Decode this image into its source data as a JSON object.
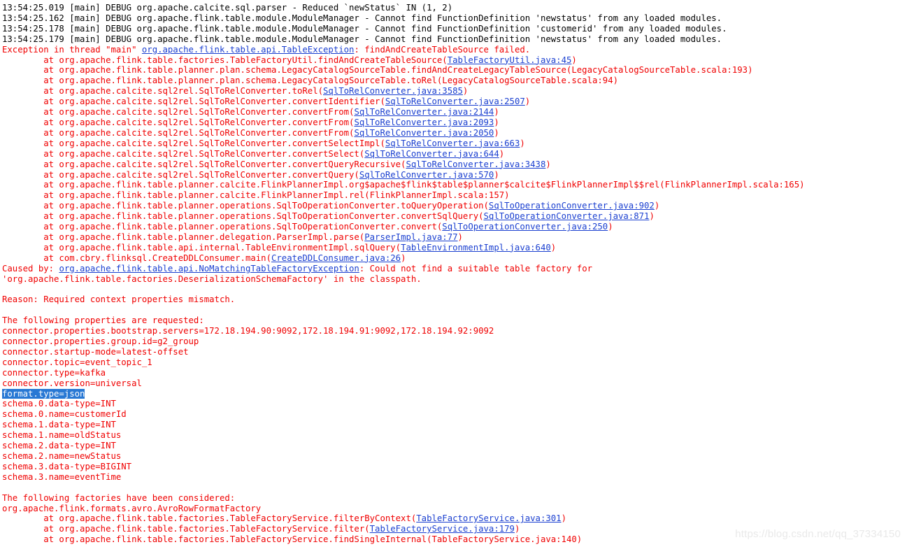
{
  "console": {
    "title": "Run console output",
    "colors": {
      "background": "#ffffff",
      "debug_text": "#000000",
      "error_text": "#f00000",
      "link": "#1a3fd0",
      "selection_background": "#2878d4",
      "selection_text": "#ffffff",
      "watermark": "#e9e9e9"
    },
    "lines": [
      {
        "kind": "debug",
        "segments": [
          {
            "type": "text",
            "text": "13:54:25.019 [main] DEBUG org.apache.calcite.sql.parser - Reduced `newStatus` IN (1, 2)"
          }
        ]
      },
      {
        "kind": "debug",
        "segments": [
          {
            "type": "text",
            "text": "13:54:25.162 [main] DEBUG org.apache.flink.table.module.ModuleManager - Cannot find FunctionDefinition 'newstatus' from any loaded modules."
          }
        ]
      },
      {
        "kind": "debug",
        "segments": [
          {
            "type": "text",
            "text": "13:54:25.178 [main] DEBUG org.apache.flink.table.module.ModuleManager - Cannot find FunctionDefinition 'customerid' from any loaded modules."
          }
        ]
      },
      {
        "kind": "debug",
        "segments": [
          {
            "type": "text",
            "text": "13:54:25.179 [main] DEBUG org.apache.flink.table.module.ModuleManager - Cannot find FunctionDefinition 'newstatus' from any loaded modules."
          }
        ]
      },
      {
        "kind": "err",
        "segments": [
          {
            "type": "text",
            "text": "Exception in thread \"main\" "
          },
          {
            "type": "link",
            "text": "org.apache.flink.table.api.TableException"
          },
          {
            "type": "text",
            "text": ": findAndCreateTableSource failed."
          }
        ]
      },
      {
        "kind": "err",
        "segments": [
          {
            "type": "text",
            "text": "        at org.apache.flink.table.factories.TableFactoryUtil.findAndCreateTableSource("
          },
          {
            "type": "link",
            "text": "TableFactoryUtil.java:45"
          },
          {
            "type": "text",
            "text": ")"
          }
        ]
      },
      {
        "kind": "err",
        "segments": [
          {
            "type": "text",
            "text": "        at org.apache.flink.table.planner.plan.schema.LegacyCatalogSourceTable.findAndCreateLegacyTableSource(LegacyCatalogSourceTable.scala:193)"
          }
        ]
      },
      {
        "kind": "err",
        "segments": [
          {
            "type": "text",
            "text": "        at org.apache.flink.table.planner.plan.schema.LegacyCatalogSourceTable.toRel(LegacyCatalogSourceTable.scala:94)"
          }
        ]
      },
      {
        "kind": "err",
        "segments": [
          {
            "type": "text",
            "text": "        at org.apache.calcite.sql2rel.SqlToRelConverter.toRel("
          },
          {
            "type": "link",
            "text": "SqlToRelConverter.java:3585"
          },
          {
            "type": "text",
            "text": ")"
          }
        ]
      },
      {
        "kind": "err",
        "segments": [
          {
            "type": "text",
            "text": "        at org.apache.calcite.sql2rel.SqlToRelConverter.convertIdentifier("
          },
          {
            "type": "link",
            "text": "SqlToRelConverter.java:2507"
          },
          {
            "type": "text",
            "text": ")"
          }
        ]
      },
      {
        "kind": "err",
        "segments": [
          {
            "type": "text",
            "text": "        at org.apache.calcite.sql2rel.SqlToRelConverter.convertFrom("
          },
          {
            "type": "link",
            "text": "SqlToRelConverter.java:2144"
          },
          {
            "type": "text",
            "text": ")"
          }
        ]
      },
      {
        "kind": "err",
        "segments": [
          {
            "type": "text",
            "text": "        at org.apache.calcite.sql2rel.SqlToRelConverter.convertFrom("
          },
          {
            "type": "link",
            "text": "SqlToRelConverter.java:2093"
          },
          {
            "type": "text",
            "text": ")"
          }
        ]
      },
      {
        "kind": "err",
        "segments": [
          {
            "type": "text",
            "text": "        at org.apache.calcite.sql2rel.SqlToRelConverter.convertFrom("
          },
          {
            "type": "link",
            "text": "SqlToRelConverter.java:2050"
          },
          {
            "type": "text",
            "text": ")"
          }
        ]
      },
      {
        "kind": "err",
        "segments": [
          {
            "type": "text",
            "text": "        at org.apache.calcite.sql2rel.SqlToRelConverter.convertSelectImpl("
          },
          {
            "type": "link",
            "text": "SqlToRelConverter.java:663"
          },
          {
            "type": "text",
            "text": ")"
          }
        ]
      },
      {
        "kind": "err",
        "segments": [
          {
            "type": "text",
            "text": "        at org.apache.calcite.sql2rel.SqlToRelConverter.convertSelect("
          },
          {
            "type": "link",
            "text": "SqlToRelConverter.java:644"
          },
          {
            "type": "text",
            "text": ")"
          }
        ]
      },
      {
        "kind": "err",
        "segments": [
          {
            "type": "text",
            "text": "        at org.apache.calcite.sql2rel.SqlToRelConverter.convertQueryRecursive("
          },
          {
            "type": "link",
            "text": "SqlToRelConverter.java:3438"
          },
          {
            "type": "text",
            "text": ")"
          }
        ]
      },
      {
        "kind": "err",
        "segments": [
          {
            "type": "text",
            "text": "        at org.apache.calcite.sql2rel.SqlToRelConverter.convertQuery("
          },
          {
            "type": "link",
            "text": "SqlToRelConverter.java:570"
          },
          {
            "type": "text",
            "text": ")"
          }
        ]
      },
      {
        "kind": "err",
        "segments": [
          {
            "type": "text",
            "text": "        at org.apache.flink.table.planner.calcite.FlinkPlannerImpl.org$apache$flink$table$planner$calcite$FlinkPlannerImpl$$rel(FlinkPlannerImpl.scala:165)"
          }
        ]
      },
      {
        "kind": "err",
        "segments": [
          {
            "type": "text",
            "text": "        at org.apache.flink.table.planner.calcite.FlinkPlannerImpl.rel(FlinkPlannerImpl.scala:157)"
          }
        ]
      },
      {
        "kind": "err",
        "segments": [
          {
            "type": "text",
            "text": "        at org.apache.flink.table.planner.operations.SqlToOperationConverter.toQueryOperation("
          },
          {
            "type": "link",
            "text": "SqlToOperationConverter.java:902"
          },
          {
            "type": "text",
            "text": ")"
          }
        ]
      },
      {
        "kind": "err",
        "segments": [
          {
            "type": "text",
            "text": "        at org.apache.flink.table.planner.operations.SqlToOperationConverter.convertSqlQuery("
          },
          {
            "type": "link",
            "text": "SqlToOperationConverter.java:871"
          },
          {
            "type": "text",
            "text": ")"
          }
        ]
      },
      {
        "kind": "err",
        "segments": [
          {
            "type": "text",
            "text": "        at org.apache.flink.table.planner.operations.SqlToOperationConverter.convert("
          },
          {
            "type": "link",
            "text": "SqlToOperationConverter.java:250"
          },
          {
            "type": "text",
            "text": ")"
          }
        ]
      },
      {
        "kind": "err",
        "segments": [
          {
            "type": "text",
            "text": "        at org.apache.flink.table.planner.delegation.ParserImpl.parse("
          },
          {
            "type": "link",
            "text": "ParserImpl.java:77"
          },
          {
            "type": "text",
            "text": ")"
          }
        ]
      },
      {
        "kind": "err",
        "segments": [
          {
            "type": "text",
            "text": "        at org.apache.flink.table.api.internal.TableEnvironmentImpl.sqlQuery("
          },
          {
            "type": "link",
            "text": "TableEnvironmentImpl.java:640"
          },
          {
            "type": "text",
            "text": ")"
          }
        ]
      },
      {
        "kind": "err",
        "segments": [
          {
            "type": "text",
            "text": "        at com.cbry.flinksql.CreateDDLConsumer.main("
          },
          {
            "type": "link",
            "text": "CreateDDLConsumer.java:26"
          },
          {
            "type": "text",
            "text": ")"
          }
        ]
      },
      {
        "kind": "err",
        "wrap": true,
        "segments": [
          {
            "type": "text",
            "text": "Caused by: "
          },
          {
            "type": "link",
            "text": "org.apache.flink.table.api.NoMatchingTableFactoryException"
          },
          {
            "type": "text",
            "text": ": Could not find a suitable table factory for 'org.apache.flink.table.factories.DeserializationSchemaFactory' in the classpath."
          }
        ]
      },
      {
        "kind": "blank",
        "segments": [
          {
            "type": "text",
            "text": " "
          }
        ]
      },
      {
        "kind": "err",
        "segments": [
          {
            "type": "text",
            "text": "Reason: Required context properties mismatch."
          }
        ]
      },
      {
        "kind": "blank",
        "segments": [
          {
            "type": "text",
            "text": " "
          }
        ]
      },
      {
        "kind": "err",
        "segments": [
          {
            "type": "text",
            "text": "The following properties are requested:"
          }
        ]
      },
      {
        "kind": "err",
        "segments": [
          {
            "type": "text",
            "text": "connector.properties.bootstrap.servers=172.18.194.90:9092,172.18.194.91:9092,172.18.194.92:9092"
          }
        ]
      },
      {
        "kind": "err",
        "segments": [
          {
            "type": "text",
            "text": "connector.properties.group.id=g2_group"
          }
        ]
      },
      {
        "kind": "err",
        "segments": [
          {
            "type": "text",
            "text": "connector.startup-mode=latest-offset"
          }
        ]
      },
      {
        "kind": "err",
        "segments": [
          {
            "type": "text",
            "text": "connector.topic=event_topic_1"
          }
        ]
      },
      {
        "kind": "err",
        "segments": [
          {
            "type": "text",
            "text": "connector.type=kafka"
          }
        ]
      },
      {
        "kind": "err",
        "segments": [
          {
            "type": "text",
            "text": "connector.version=universal"
          }
        ]
      },
      {
        "kind": "err",
        "segments": [
          {
            "type": "selection",
            "text": "format.type=json"
          }
        ]
      },
      {
        "kind": "err",
        "segments": [
          {
            "type": "text",
            "text": "schema.0.data-type=INT"
          }
        ]
      },
      {
        "kind": "err",
        "segments": [
          {
            "type": "text",
            "text": "schema.0.name=customerId"
          }
        ]
      },
      {
        "kind": "err",
        "segments": [
          {
            "type": "text",
            "text": "schema.1.data-type=INT"
          }
        ]
      },
      {
        "kind": "err",
        "segments": [
          {
            "type": "text",
            "text": "schema.1.name=oldStatus"
          }
        ]
      },
      {
        "kind": "err",
        "segments": [
          {
            "type": "text",
            "text": "schema.2.data-type=INT"
          }
        ]
      },
      {
        "kind": "err",
        "segments": [
          {
            "type": "text",
            "text": "schema.2.name=newStatus"
          }
        ]
      },
      {
        "kind": "err",
        "segments": [
          {
            "type": "text",
            "text": "schema.3.data-type=BIGINT"
          }
        ]
      },
      {
        "kind": "err",
        "segments": [
          {
            "type": "text",
            "text": "schema.3.name=eventTime"
          }
        ]
      },
      {
        "kind": "blank",
        "segments": [
          {
            "type": "text",
            "text": " "
          }
        ]
      },
      {
        "kind": "err",
        "segments": [
          {
            "type": "text",
            "text": "The following factories have been considered:"
          }
        ]
      },
      {
        "kind": "err",
        "segments": [
          {
            "type": "text",
            "text": "org.apache.flink.formats.avro.AvroRowFormatFactory"
          }
        ]
      },
      {
        "kind": "err",
        "segments": [
          {
            "type": "text",
            "text": "        at org.apache.flink.table.factories.TableFactoryService.filterByContext("
          },
          {
            "type": "link",
            "text": "TableFactoryService.java:301"
          },
          {
            "type": "text",
            "text": ")"
          }
        ]
      },
      {
        "kind": "err",
        "segments": [
          {
            "type": "text",
            "text": "        at org.apache.flink.table.factories.TableFactoryService.filter("
          },
          {
            "type": "link",
            "text": "TableFactoryService.java:179"
          },
          {
            "type": "text",
            "text": ")"
          }
        ]
      },
      {
        "kind": "err",
        "segments": [
          {
            "type": "text",
            "text": "        at org.apache.flink.table.factories.TableFactoryService.findSingleInternal(TableFactoryService.java:140)"
          }
        ]
      }
    ]
  },
  "watermark": {
    "text": "https://blog.csdn.net/qq_37334150"
  }
}
